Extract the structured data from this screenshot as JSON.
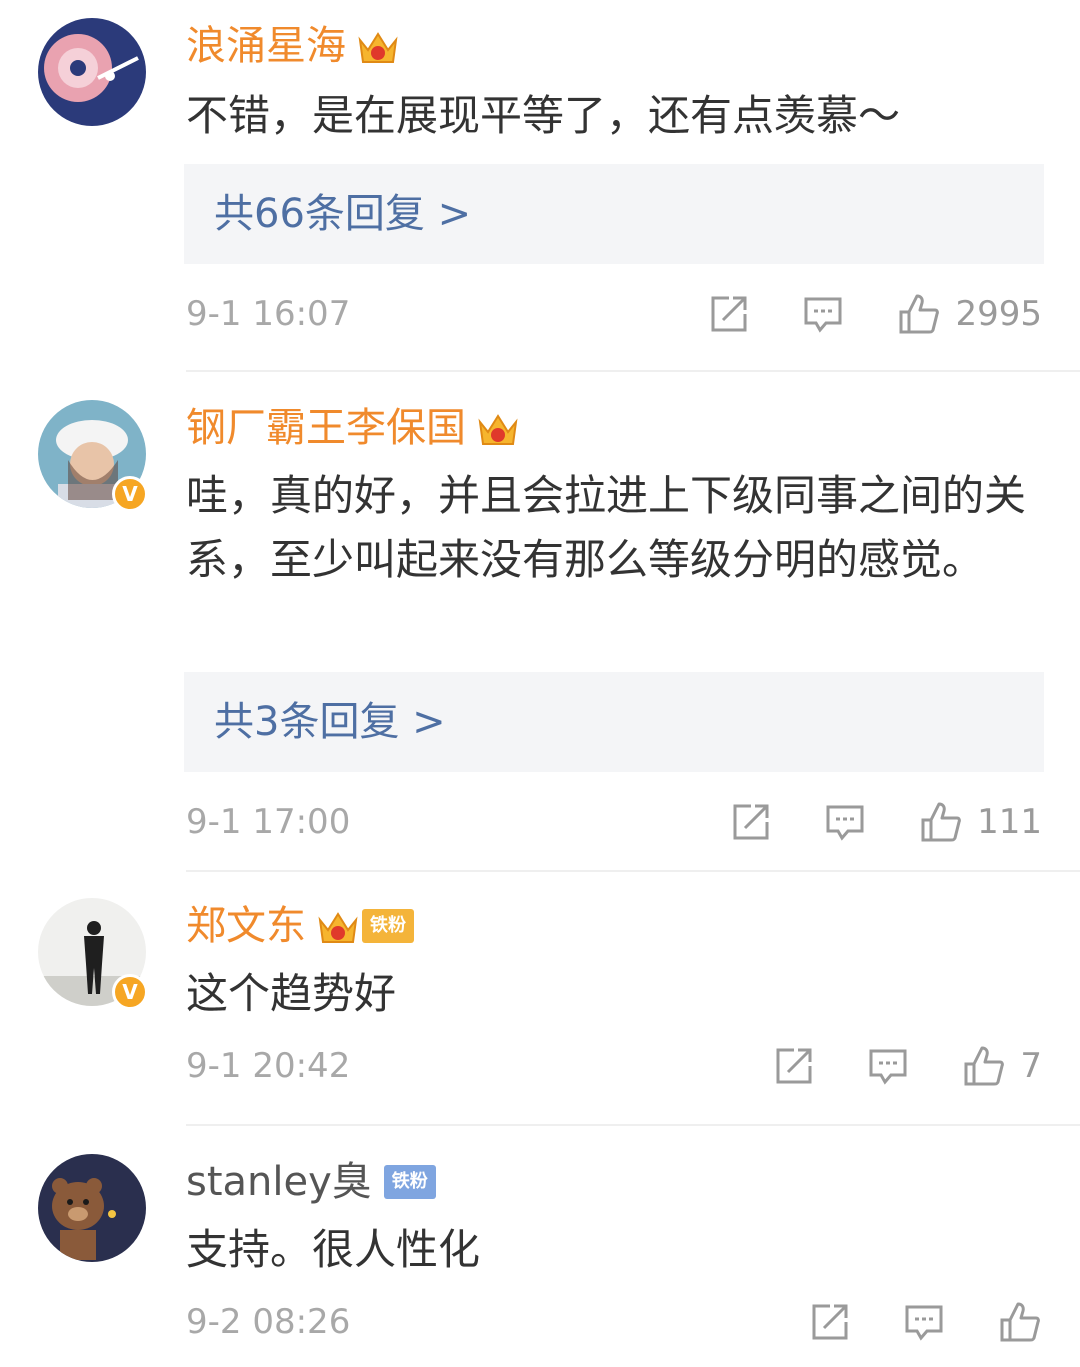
{
  "comments": [
    {
      "username": "浪涌星海",
      "text": "不错，是在展现平等了，还有点羡慕～",
      "reply_link": "共66条回复 >",
      "time": "9-1 16:07",
      "likes": "2995"
    },
    {
      "username": "钢厂霸王李保国",
      "text": "哇，真的好，并且会拉进上下级同事之间的关系，至少叫起来没有那么等级分明的感觉。",
      "reply_link": "共3条回复 >",
      "time": "9-1 17:00",
      "likes": "111",
      "verified": "V"
    },
    {
      "username": "郑文东",
      "badge": "铁粉",
      "text": "这个趋势好",
      "time": "9-1 20:42",
      "likes": "7",
      "verified": "V"
    },
    {
      "username": "stanley臭",
      "badge": "铁粉",
      "text": "支持。很人性化",
      "time": "9-2 08:26",
      "likes": ""
    }
  ],
  "colors": {
    "username": "#f08a2c",
    "link": "#4e6fa3",
    "timestamp": "#a8a8a8",
    "reply_bg": "#f4f5f7",
    "verified": "#f6a623",
    "fan_badge_blue": "#7fa5e0"
  },
  "icons": [
    "crown-icon",
    "share-icon",
    "comment-icon",
    "like-icon",
    "verified-icon"
  ]
}
